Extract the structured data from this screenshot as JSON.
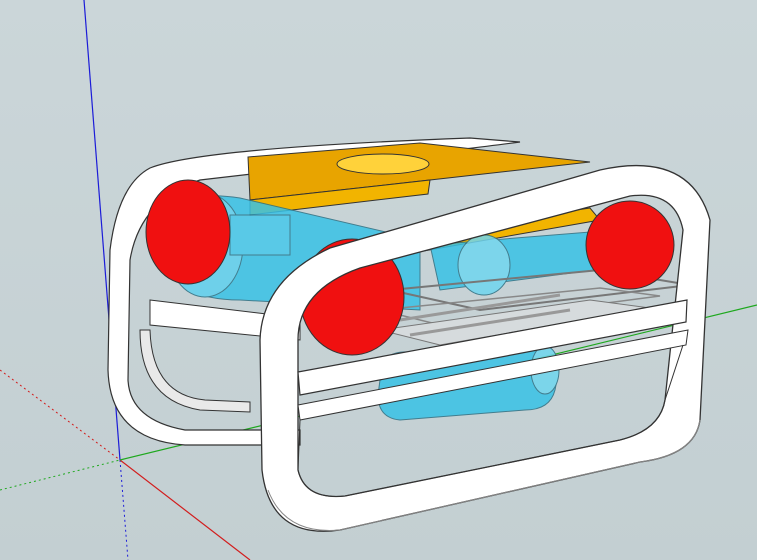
{
  "app": {
    "title": ""
  },
  "viewport": {
    "background_color": "#c8d3d6",
    "axes": {
      "x_axis_color": "#d21d1d",
      "y_axis_color": "#1ea81e",
      "z_axis_color": "#1c1cd8"
    }
  },
  "model": {
    "name": "",
    "colors": {
      "frame": "#ffffff",
      "frame_shadow": "#d9d9d9",
      "top_plate": "#e8a400",
      "top_plate_side": "#f0b000",
      "hole": "#ffd23a",
      "float_end": "#f01010",
      "transparent_body": "#38c2e6",
      "rails": "#9a9a9a"
    }
  }
}
